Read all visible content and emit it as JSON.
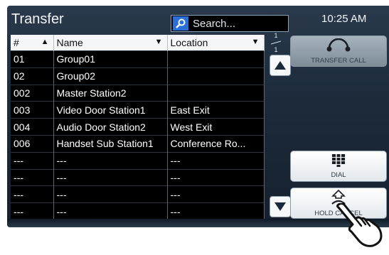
{
  "screen": {
    "title": "Transfer",
    "search_placeholder": "Search...",
    "time": "10:25 AM"
  },
  "table": {
    "columns": [
      "#",
      "Name",
      "Location"
    ],
    "rows": [
      [
        "01",
        "Group01",
        ""
      ],
      [
        "02",
        "Group02",
        ""
      ],
      [
        "002",
        "Master Station2",
        ""
      ],
      [
        "003",
        "Video Door Station1",
        "East Exit"
      ],
      [
        "004",
        "Audio Door Station2",
        "West Exit"
      ],
      [
        "006",
        "Handset Sub Station1",
        "Conference Ro..."
      ],
      [
        "---",
        "---",
        "---"
      ],
      [
        "---",
        "---",
        "---"
      ],
      [
        "---",
        "---",
        "---"
      ],
      [
        "---",
        "---",
        "---"
      ]
    ]
  },
  "pager": {
    "current": "1",
    "total": "1"
  },
  "buttons": {
    "transfer_call": "TRANSFER CALL",
    "dial": "DIAL",
    "hold_cancel": "HOLD CANCEL"
  },
  "icons": {
    "search": "search-icon",
    "transfer": "handset-arc-icon",
    "dial": "keypad-icon",
    "hold_cancel": "phone-up-arrow-icon",
    "pointer": "pointing-hand-icon"
  }
}
